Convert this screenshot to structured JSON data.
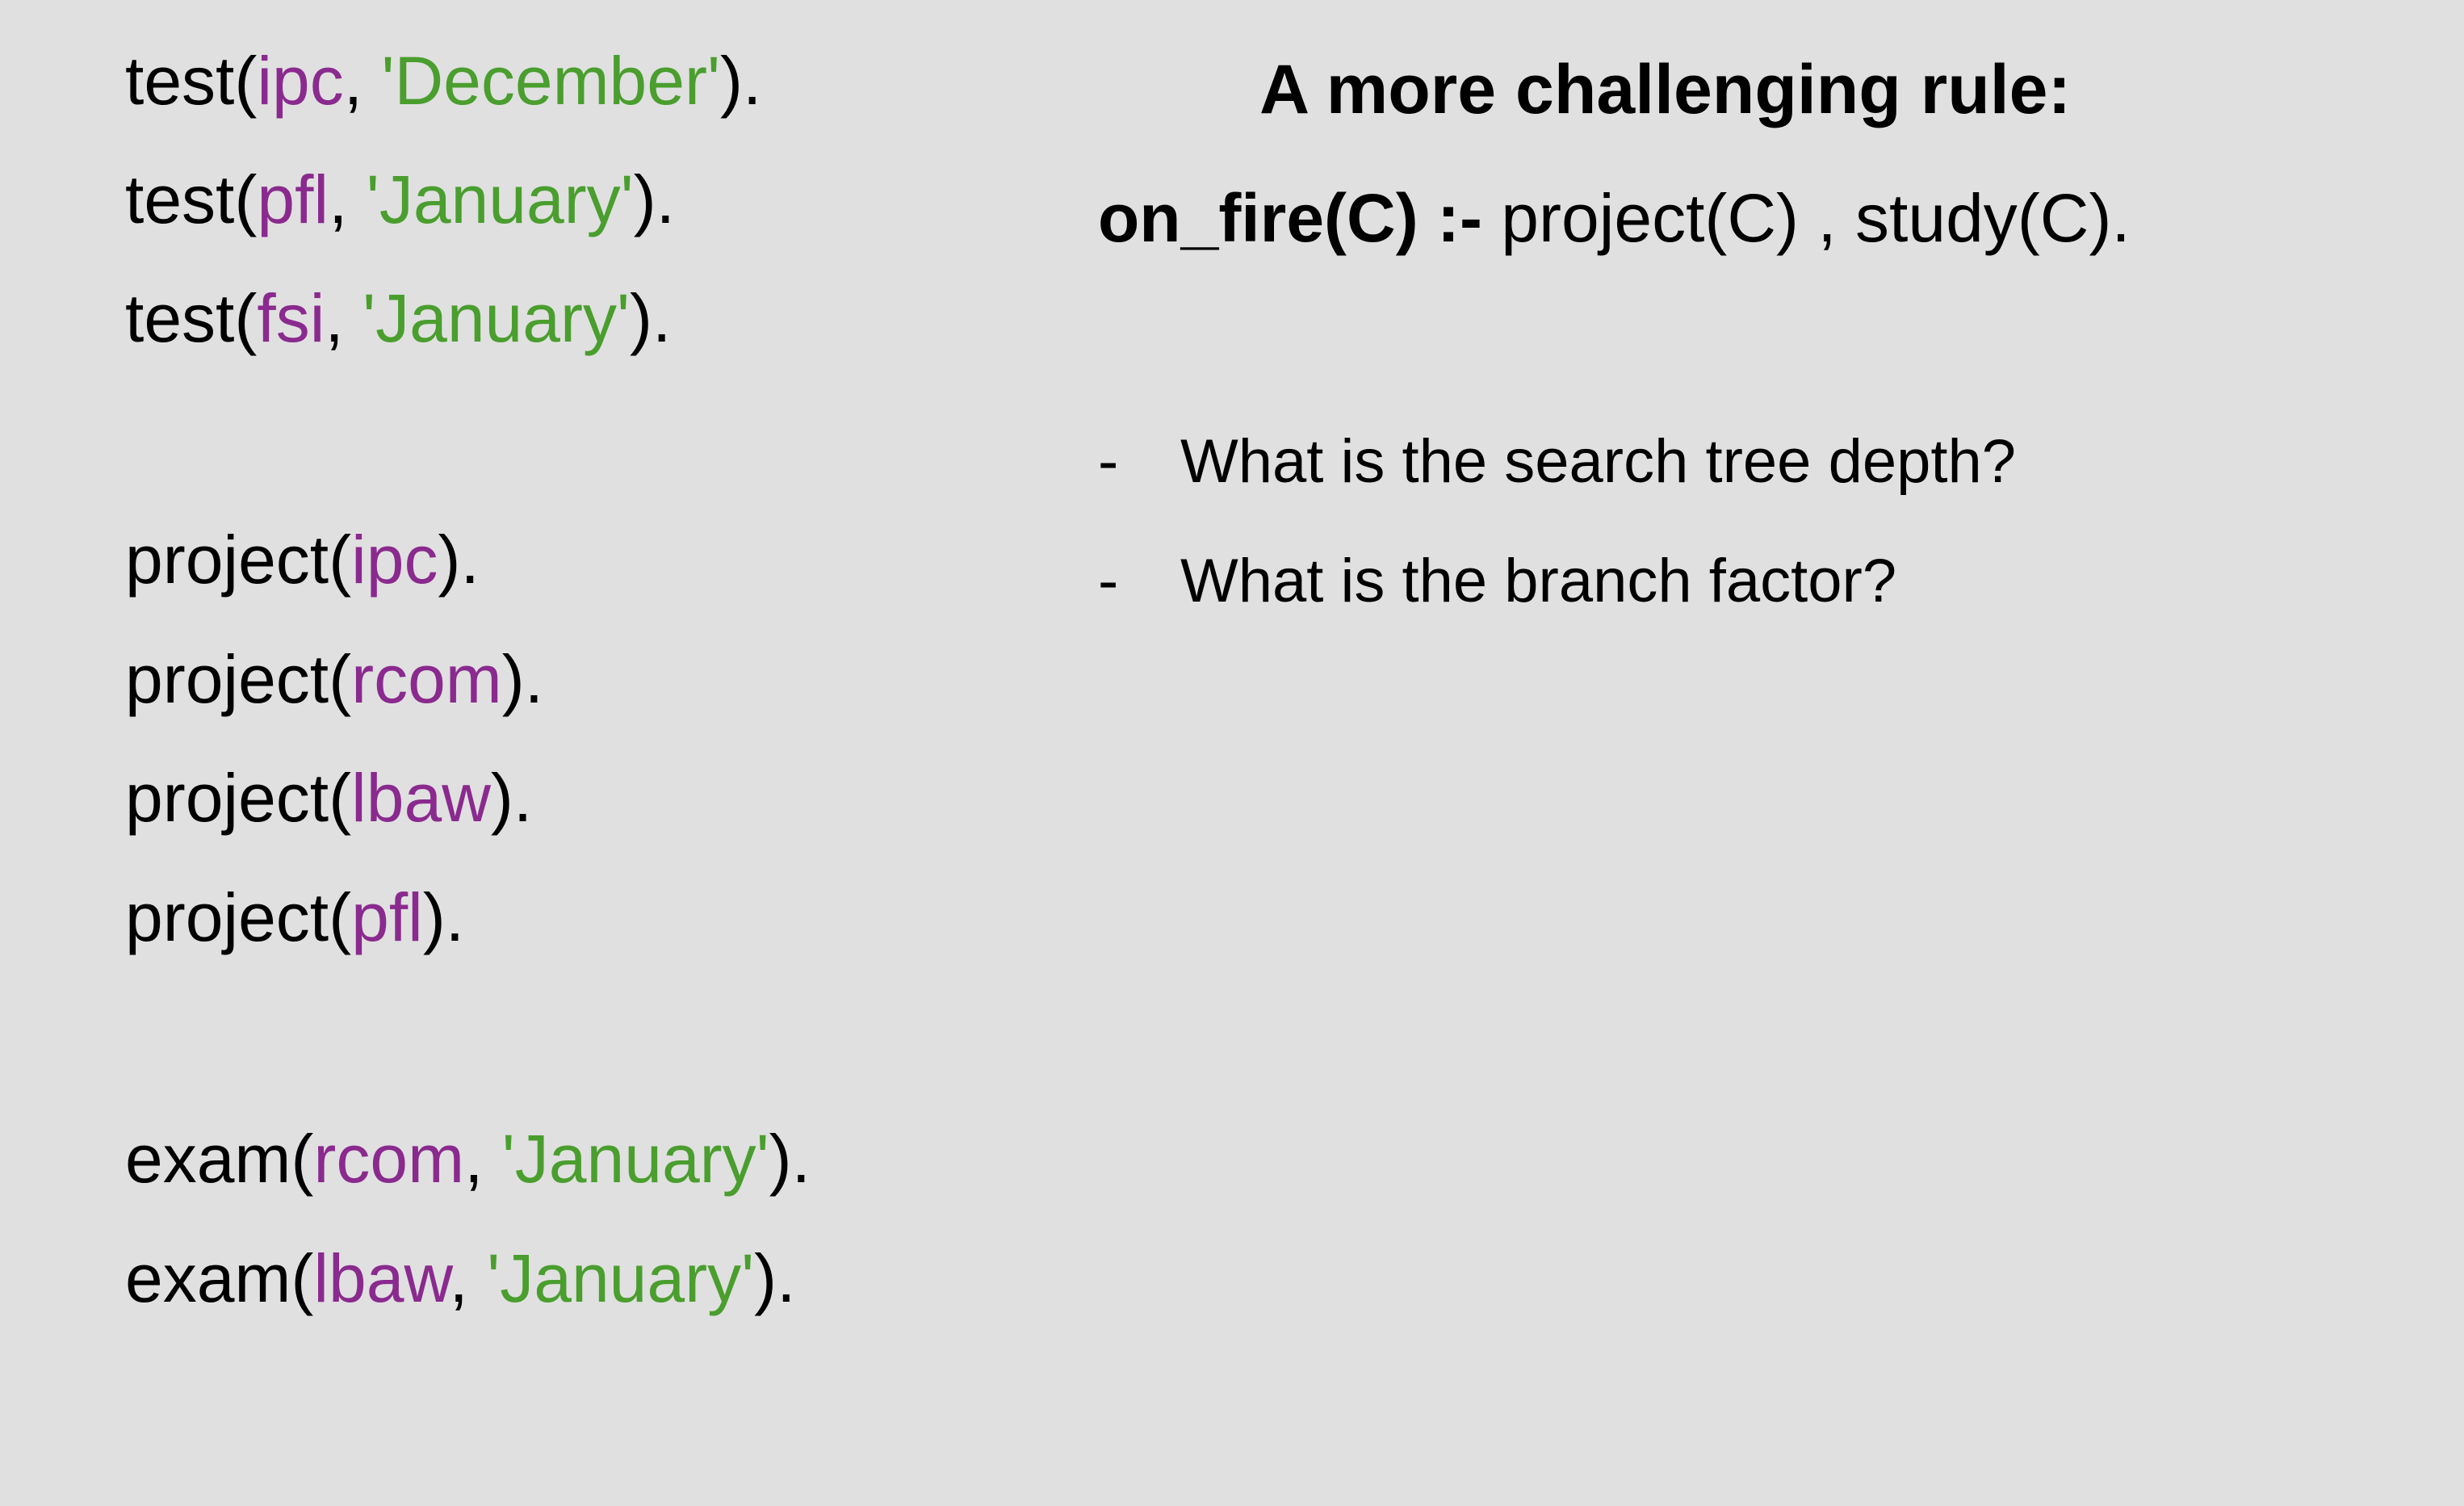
{
  "facts": {
    "test": [
      {
        "pred": "test(",
        "arg": "ipc",
        "sep": ", ",
        "str": "'December'",
        "end": ")."
      },
      {
        "pred": "test(",
        "arg": "pfl",
        "sep": ", ",
        "str": "'January'",
        "end": ")."
      },
      {
        "pred": "test(",
        "arg": "fsi",
        "sep": ", ",
        "str": "'January'",
        "end": ")."
      }
    ],
    "project": [
      {
        "pred": "project(",
        "arg": "ipc",
        "end": ")."
      },
      {
        "pred": "project(",
        "arg": "rcom",
        "end": ")."
      },
      {
        "pred": "project(",
        "arg": "lbaw",
        "end": ")."
      },
      {
        "pred": "project(",
        "arg": "pfl",
        "end": ")."
      }
    ],
    "exam": [
      {
        "pred": "exam(",
        "arg": "rcom",
        "sep": ", ",
        "str": "'January'",
        "end": ")."
      },
      {
        "pred": "exam(",
        "arg": "lbaw",
        "sep": ", ",
        "str": "'January'",
        "end": ")."
      }
    ]
  },
  "title": "A more challenging rule:",
  "rule": {
    "head": "on_fire(C) :-",
    "body": " project(C) , study(C)."
  },
  "questions": [
    {
      "dash": "-",
      "text": "What is the search tree depth?"
    },
    {
      "dash": "-",
      "text": "What is the branch factor?"
    }
  ],
  "colors": {
    "background": "#e0e0e0",
    "atom": "#8a2a8e",
    "string": "#4a9e2e"
  }
}
